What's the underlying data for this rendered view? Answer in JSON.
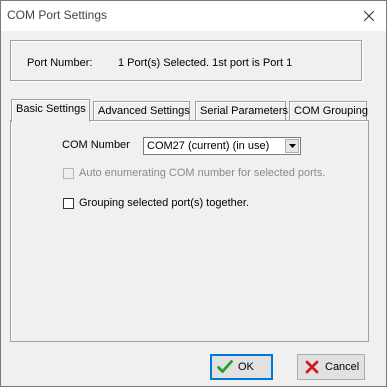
{
  "window": {
    "title": "COM Port Settings"
  },
  "info": {
    "port_label": "Port Number:",
    "port_value": "1 Port(s) Selected. 1st port is Port 1"
  },
  "tabs": [
    {
      "label": "Basic Settings",
      "active": true
    },
    {
      "label": "Advanced Settings",
      "active": false
    },
    {
      "label": "Serial Parameters",
      "active": false
    },
    {
      "label": "COM Grouping",
      "active": false
    }
  ],
  "basic": {
    "com_number_label": "COM Number",
    "com_number_value": "COM27 (current) (in use)",
    "auto_enum_label": "Auto enumerating COM number for selected ports.",
    "auto_enum_checked": false,
    "auto_enum_enabled": false,
    "grouping_label": "Grouping selected port(s) together.",
    "grouping_checked": false
  },
  "buttons": {
    "ok_label": "OK",
    "cancel_label": "Cancel"
  },
  "icons": {
    "ok": "check-icon",
    "cancel": "cross-icon",
    "close": "close-icon",
    "dropdown": "chevron-down-icon"
  },
  "colors": {
    "check_green": "#2a9d2a",
    "cross_red": "#d01c1c",
    "focus_blue": "#0078d7"
  }
}
